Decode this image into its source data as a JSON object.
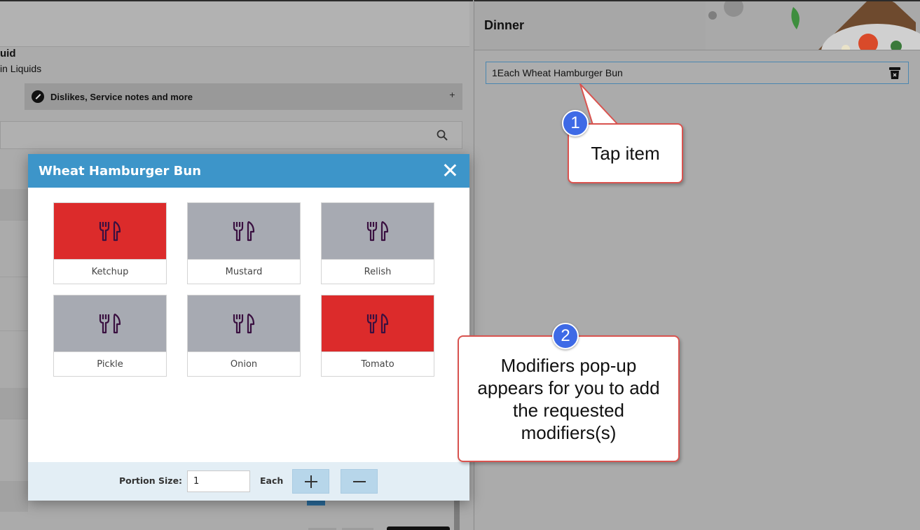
{
  "left_pane": {
    "diet_title": "uid",
    "diet_subtitle": "in Liquids",
    "dislikes_label": "Dislikes, Service notes and more",
    "dislikes_plus": "+"
  },
  "right_pane": {
    "meal_title": "Dinner",
    "order_item": "1Each Wheat Hamburger Bun"
  },
  "modal": {
    "title": "Wheat Hamburger Bun",
    "modifiers": [
      {
        "label": "Ketchup",
        "selected": true
      },
      {
        "label": "Mustard",
        "selected": false
      },
      {
        "label": "Relish",
        "selected": false
      },
      {
        "label": "Pickle",
        "selected": false
      },
      {
        "label": "Onion",
        "selected": false
      },
      {
        "label": "Tomato",
        "selected": true
      }
    ],
    "portion_label": "Portion Size:",
    "portion_value": "1",
    "portion_unit": "Each"
  },
  "callouts": {
    "step1_number": "1",
    "step1_text": "Tap item",
    "step2_number": "2",
    "step2_text": "Modifiers pop-up appears for you to add the requested modifiers(s)"
  },
  "colors": {
    "modal_header": "#3d95c9",
    "selected_tile": "#dc2b2b",
    "unselected_tile": "#a7aab2",
    "step_badge": "#3e6ae6",
    "callout_border": "#d9534f"
  }
}
